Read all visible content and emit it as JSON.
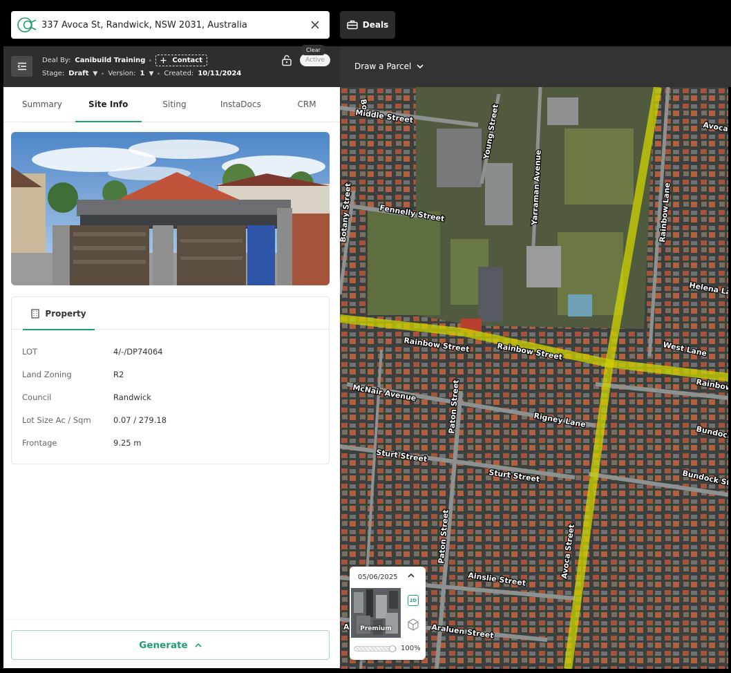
{
  "search": {
    "address": "337 Avoca St, Randwick, NSW 2031, Australia",
    "clear_tooltip": "Clear"
  },
  "deals_button": {
    "label": "Deals"
  },
  "deal": {
    "deal_by_label": "Deal By:",
    "deal_by_value": "Canibuild Training",
    "contact_label": "Contact",
    "stage_label": "Stage:",
    "stage_value": "Draft",
    "version_label": "Version:",
    "version_value": "1",
    "created_label": "Created:",
    "created_value": "10/11/2024",
    "status": "Active"
  },
  "tabs": [
    {
      "label": "Summary"
    },
    {
      "label": "Site Info",
      "active": true
    },
    {
      "label": "Siting"
    },
    {
      "label": "InstaDocs"
    },
    {
      "label": "CRM"
    }
  ],
  "property": {
    "tab_label": "Property",
    "rows": [
      {
        "key": "LOT",
        "value": "4/-/DP74064"
      },
      {
        "key": "Land Zoning",
        "value": "R2"
      },
      {
        "key": "Council",
        "value": "Randwick"
      },
      {
        "key": "Lot Size Ac / Sqm",
        "value": "0.07 / 279.18"
      },
      {
        "key": "Frontage",
        "value": "9.25 m"
      }
    ]
  },
  "generate_button": {
    "label": "Generate"
  },
  "map": {
    "draw_parcel_label": "Draw a Parcel",
    "streets": {
      "bo": "Bo",
      "middle": "Middle Street",
      "young": "Young Street",
      "yarraman": "Yarraman Avenue",
      "avoca_top": "Avoca",
      "botany": "Botany Street",
      "fennelly": "Fennelly Street",
      "rainbow_lane": "Rainbow Lane",
      "helena": "Helena Lane",
      "rainbow_w": "Rainbow Street",
      "rainbow_e": "Rainbow Street",
      "west_lane": "West Lane",
      "rainbow_r": "Rainbow",
      "mcnair": "McNair Avenue",
      "paton_n": "Paton Street",
      "rigney": "Rigney Lane",
      "bundock_1": "Bundock",
      "sturt_w": "Sturt Street",
      "sturt_e": "Sturt Street",
      "bundock_2": "Bundock Street",
      "paton_s": "Paton Street",
      "avoca_s": "Avoca Street",
      "ainslie": "Ainslie Street",
      "araluen": "Araluen Street",
      "a_edge": "A"
    }
  },
  "imagery": {
    "date": "05/06/2025",
    "layer_label": "Premium",
    "mode_2d": "2D",
    "opacity_value": 100,
    "opacity_label": "100%"
  },
  "colors": {
    "accent": "#1f9d73",
    "header_bg": "#2e2e2e",
    "road_highlight": "#d8e000"
  }
}
